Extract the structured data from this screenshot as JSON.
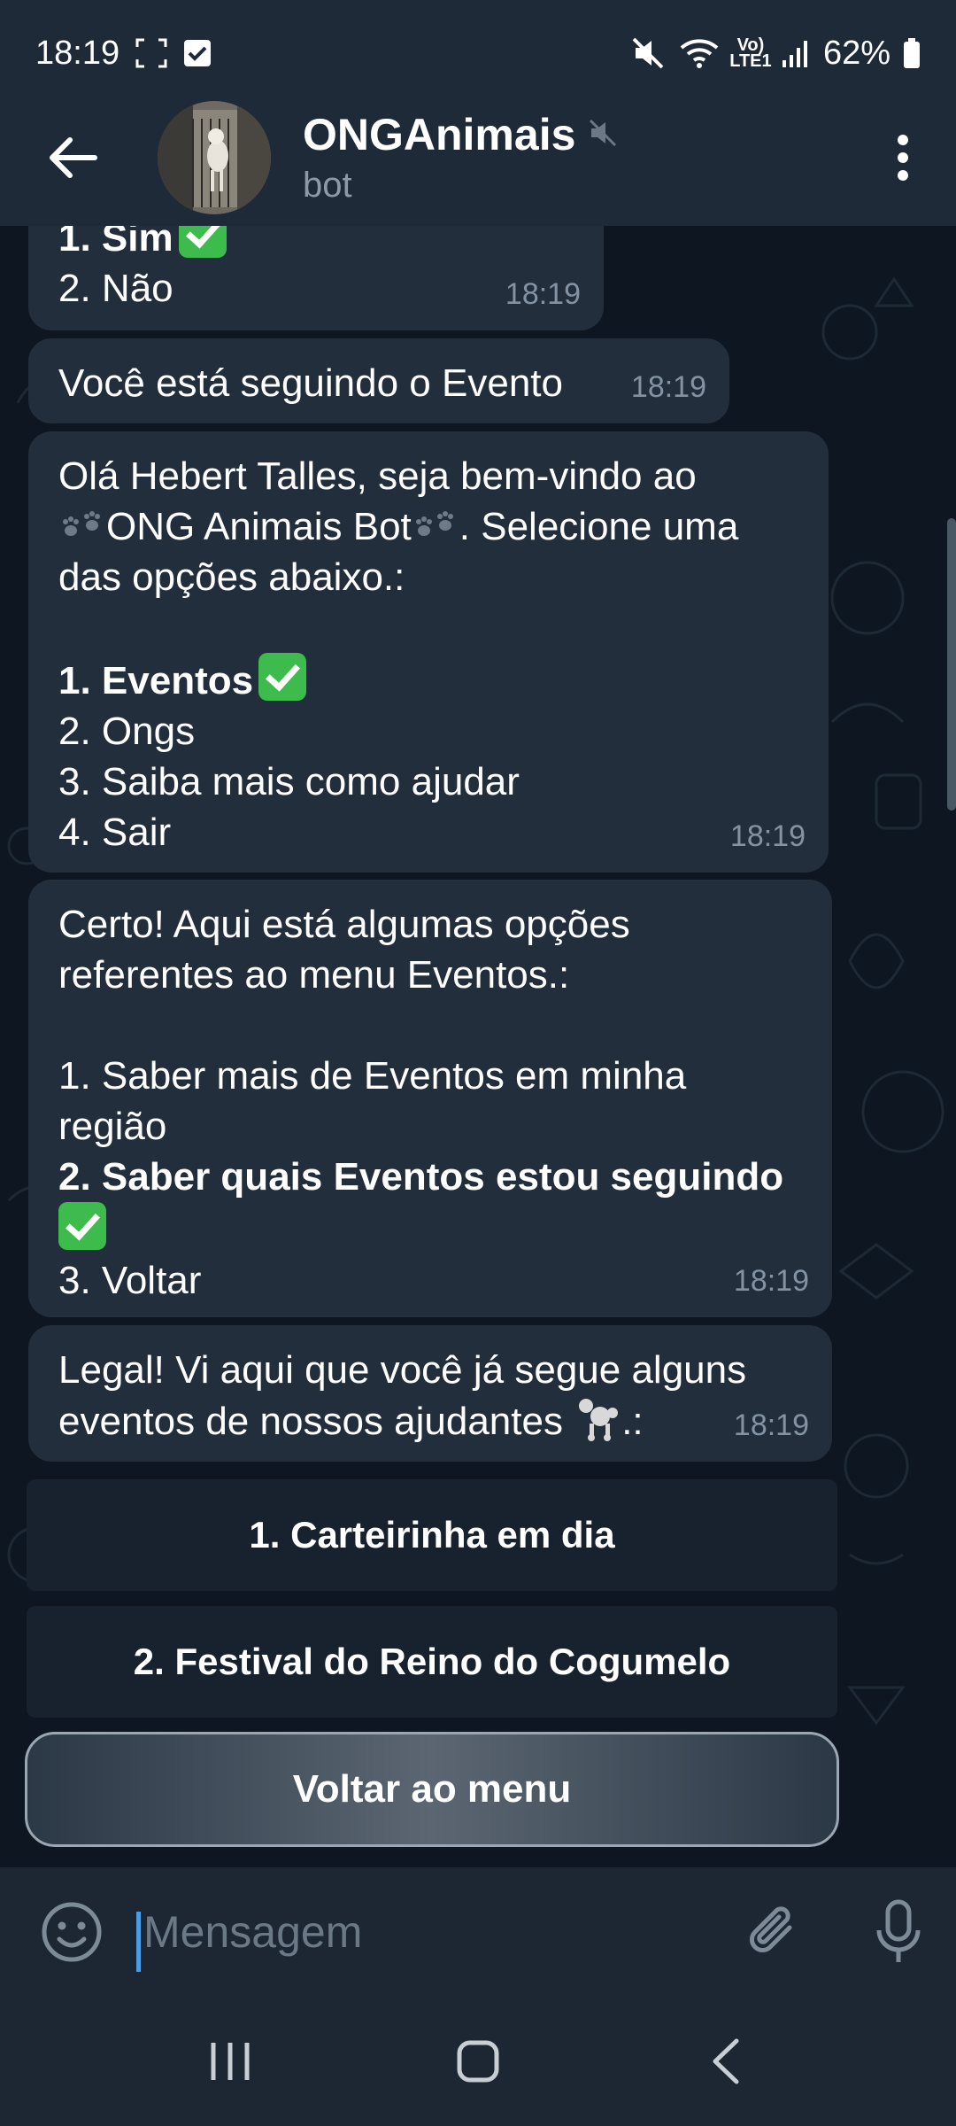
{
  "status_bar": {
    "time": "18:19",
    "battery": "62%",
    "network_label": "Vo) LTE1"
  },
  "header": {
    "title": "ONGAnimais",
    "subtitle": "bot"
  },
  "messages": [
    {
      "lines": [
        {
          "text": "1. Sim",
          "bold": true,
          "check": true
        },
        {
          "text": "2. Não",
          "bold": false
        }
      ],
      "time": "18:19"
    },
    {
      "lines": [
        {
          "text": "Você está seguindo o Evento",
          "bold": false
        }
      ],
      "time": "18:19"
    },
    {
      "lines": [
        {
          "text": "Olá Hebert Talles, seja bem-vindo ao",
          "bold": false
        },
        {
          "pre": "",
          "mid": "ONG Animais Bot",
          "post": ". Selecione uma",
          "paws": true
        },
        {
          "text": "das opções abaixo.:",
          "bold": false
        },
        {
          "text": "",
          "bold": false
        },
        {
          "text": "1. Eventos",
          "bold": true,
          "check": true
        },
        {
          "text": "2. Ongs",
          "bold": false
        },
        {
          "text": "3. Saiba mais como ajudar",
          "bold": false
        },
        {
          "text": "4. Sair",
          "bold": false
        }
      ],
      "time": "18:19"
    },
    {
      "lines": [
        {
          "text": "Certo! Aqui está algumas opções",
          "bold": false
        },
        {
          "text": "referentes ao menu Eventos.:",
          "bold": false
        },
        {
          "text": "",
          "bold": false
        },
        {
          "text": "1. Saber mais de Eventos em minha",
          "bold": false
        },
        {
          "text": "região",
          "bold": false
        },
        {
          "text": "2. Saber quais Eventos estou seguindo",
          "bold": true
        },
        {
          "text": "",
          "bold": false,
          "check": true
        },
        {
          "text": "3. Voltar",
          "bold": false
        }
      ],
      "time": "18:19"
    },
    {
      "lines": [
        {
          "text": "Legal! Vi aqui que você já segue alguns",
          "bold": false
        },
        {
          "text": "eventos de nossos ajudantes",
          "bold": false,
          "poodle": true,
          "suffix": ".:"
        }
      ],
      "time": "18:19"
    }
  ],
  "inline_buttons": [
    "1. Carteirinha em dia",
    "2. Festival do Reino do Cogumelo"
  ],
  "menu_button": "Voltar ao menu",
  "input": {
    "placeholder": "Mensagem"
  },
  "colors": {
    "bubble": "#222e3c",
    "background": "#0e1621",
    "header": "#1e2a38",
    "check_green": "#3dbb4d"
  }
}
